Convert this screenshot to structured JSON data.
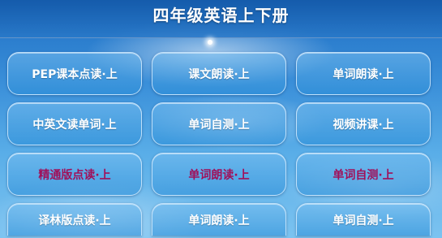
{
  "header": {
    "title": "四年级英语上下册"
  },
  "colors": {
    "primary_text": "#ffffff",
    "accent_text": "#a0105a",
    "sky_top": "#1f6fc4",
    "sky_bottom": "#7cc3f0"
  },
  "rows": [
    {
      "buttons": [
        {
          "label": "PEP课本点读·上"
        },
        {
          "label": "课文朗读·上"
        },
        {
          "label": "单词朗读·上"
        }
      ]
    },
    {
      "buttons": [
        {
          "label": "中英文读单词·上"
        },
        {
          "label": "单词自测·上"
        },
        {
          "label": "视频讲课·上"
        }
      ]
    },
    {
      "buttons": [
        {
          "label": "精通版点读·上"
        },
        {
          "label": "单词朗读·上"
        },
        {
          "label": "单词自测·上"
        }
      ]
    },
    {
      "buttons": [
        {
          "label": "译林版点读·上"
        },
        {
          "label": "单词朗读·上"
        },
        {
          "label": "单词自测·上"
        }
      ]
    }
  ]
}
